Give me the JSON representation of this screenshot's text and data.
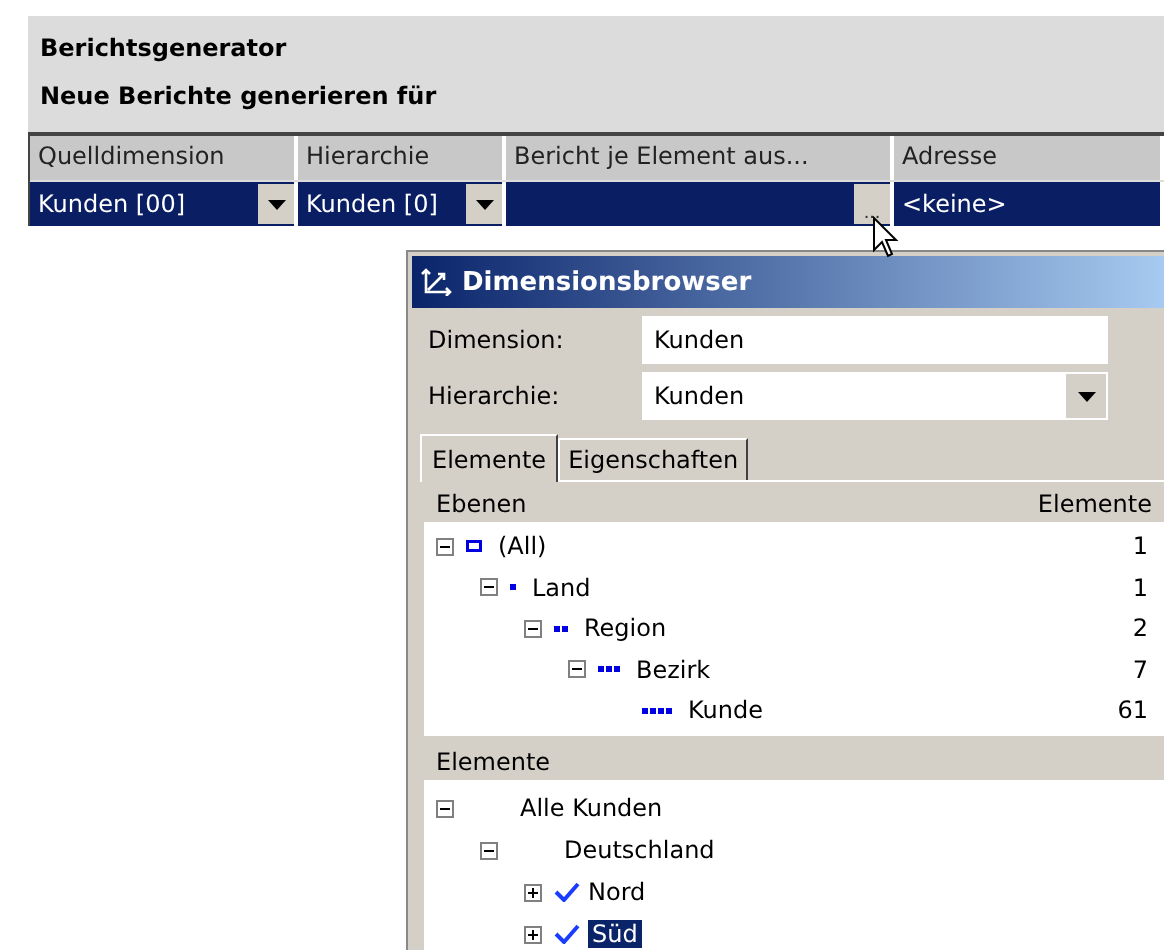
{
  "panel": {
    "title": "Berichtsgenerator",
    "subtitle": "Neue Berichte generieren für"
  },
  "grid": {
    "columns": [
      "Quelldimension",
      "Hierarchie",
      "Bericht je Element aus...",
      "Adresse"
    ],
    "rows": [
      {
        "selected": true,
        "cells": [
          {
            "kind": "dropdown",
            "value": "Kunden [00]"
          },
          {
            "kind": "dropdown",
            "value": "Kunden [0]"
          },
          {
            "kind": "browse",
            "button": "..."
          },
          {
            "kind": "text",
            "value": "<keine>"
          }
        ]
      }
    ]
  },
  "dialog": {
    "title": "Dimensionsbrowser",
    "dimension": {
      "label": "Dimension:",
      "value": "Kunden"
    },
    "hierarchy": {
      "label": "Hierarchie:",
      "value": "Kunden"
    },
    "tabs": [
      {
        "label": "Elemente",
        "selected": true
      },
      {
        "label": "Eigenschaften",
        "selected": false
      }
    ],
    "levels": {
      "columns": [
        "Ebenen",
        "Elemente"
      ],
      "items": [
        {
          "name": "(All)",
          "count": "1",
          "expanded": true,
          "children": [
            {
              "name": "Land",
              "count": "1",
              "expanded": true,
              "children": [
                {
                  "name": "Region",
                  "count": "2",
                  "expanded": true,
                  "children": [
                    {
                      "name": "Bezirk",
                      "count": "7",
                      "expanded": true,
                      "children": [
                        {
                          "name": "Kunde",
                          "count": "61"
                        }
                      ]
                    }
                  ]
                }
              ]
            }
          ]
        }
      ]
    },
    "elements": {
      "header": "Elemente",
      "items": [
        {
          "name": "Alle Kunden",
          "expanded": true,
          "checked": false,
          "selected": false,
          "children": [
            {
              "name": "Deutschland",
              "expanded": true,
              "checked": false,
              "selected": false,
              "children": [
                {
                  "name": "Nord",
                  "expanded": false,
                  "checked": true,
                  "selected": false
                },
                {
                  "name": "Süd",
                  "expanded": false,
                  "checked": true,
                  "selected": true
                }
              ]
            }
          ]
        }
      ]
    }
  }
}
